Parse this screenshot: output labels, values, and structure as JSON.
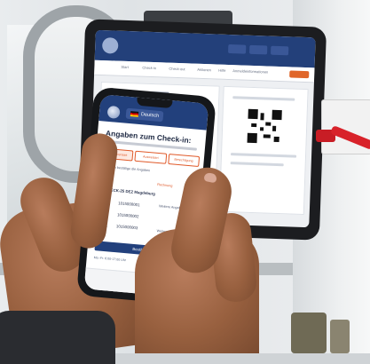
{
  "tablet": {
    "app_title": "",
    "header_buttons": [
      "",
      "",
      ""
    ],
    "nav_items": [
      "Start",
      "Check-in",
      "Check-out",
      "Aktionen",
      "Hilfe",
      "Anmeldeinformationen"
    ]
  },
  "phone": {
    "language_label": "Deutsch",
    "heading": "Angaben zum Check-in:",
    "tabs": [
      "Verfahrensart",
      "Ausweisart",
      "Berechtigung"
    ],
    "checkbox_label": "Ich bestätige die Angaben",
    "plate": "KFZ: ECK-25 DEZ Magdeburg",
    "rows": [
      {
        "label": "Zu-nr.",
        "value": "1015000001"
      },
      {
        "label": "Zu-nr.",
        "value": "1015000002"
      },
      {
        "label": "Zu-nr.",
        "value": "1015000003"
      }
    ],
    "side_notes": [
      "Rechnung",
      "Weitere Angaben",
      "Weitere Angaben"
    ],
    "submit_label": "Bestätigen",
    "address_line": "Mo.-Fr. 6:00-17:00 Uhr"
  },
  "colors": {
    "brand_blue": "#22407c",
    "accent_orange": "#e05a2a",
    "cable_red": "#d8222a"
  }
}
